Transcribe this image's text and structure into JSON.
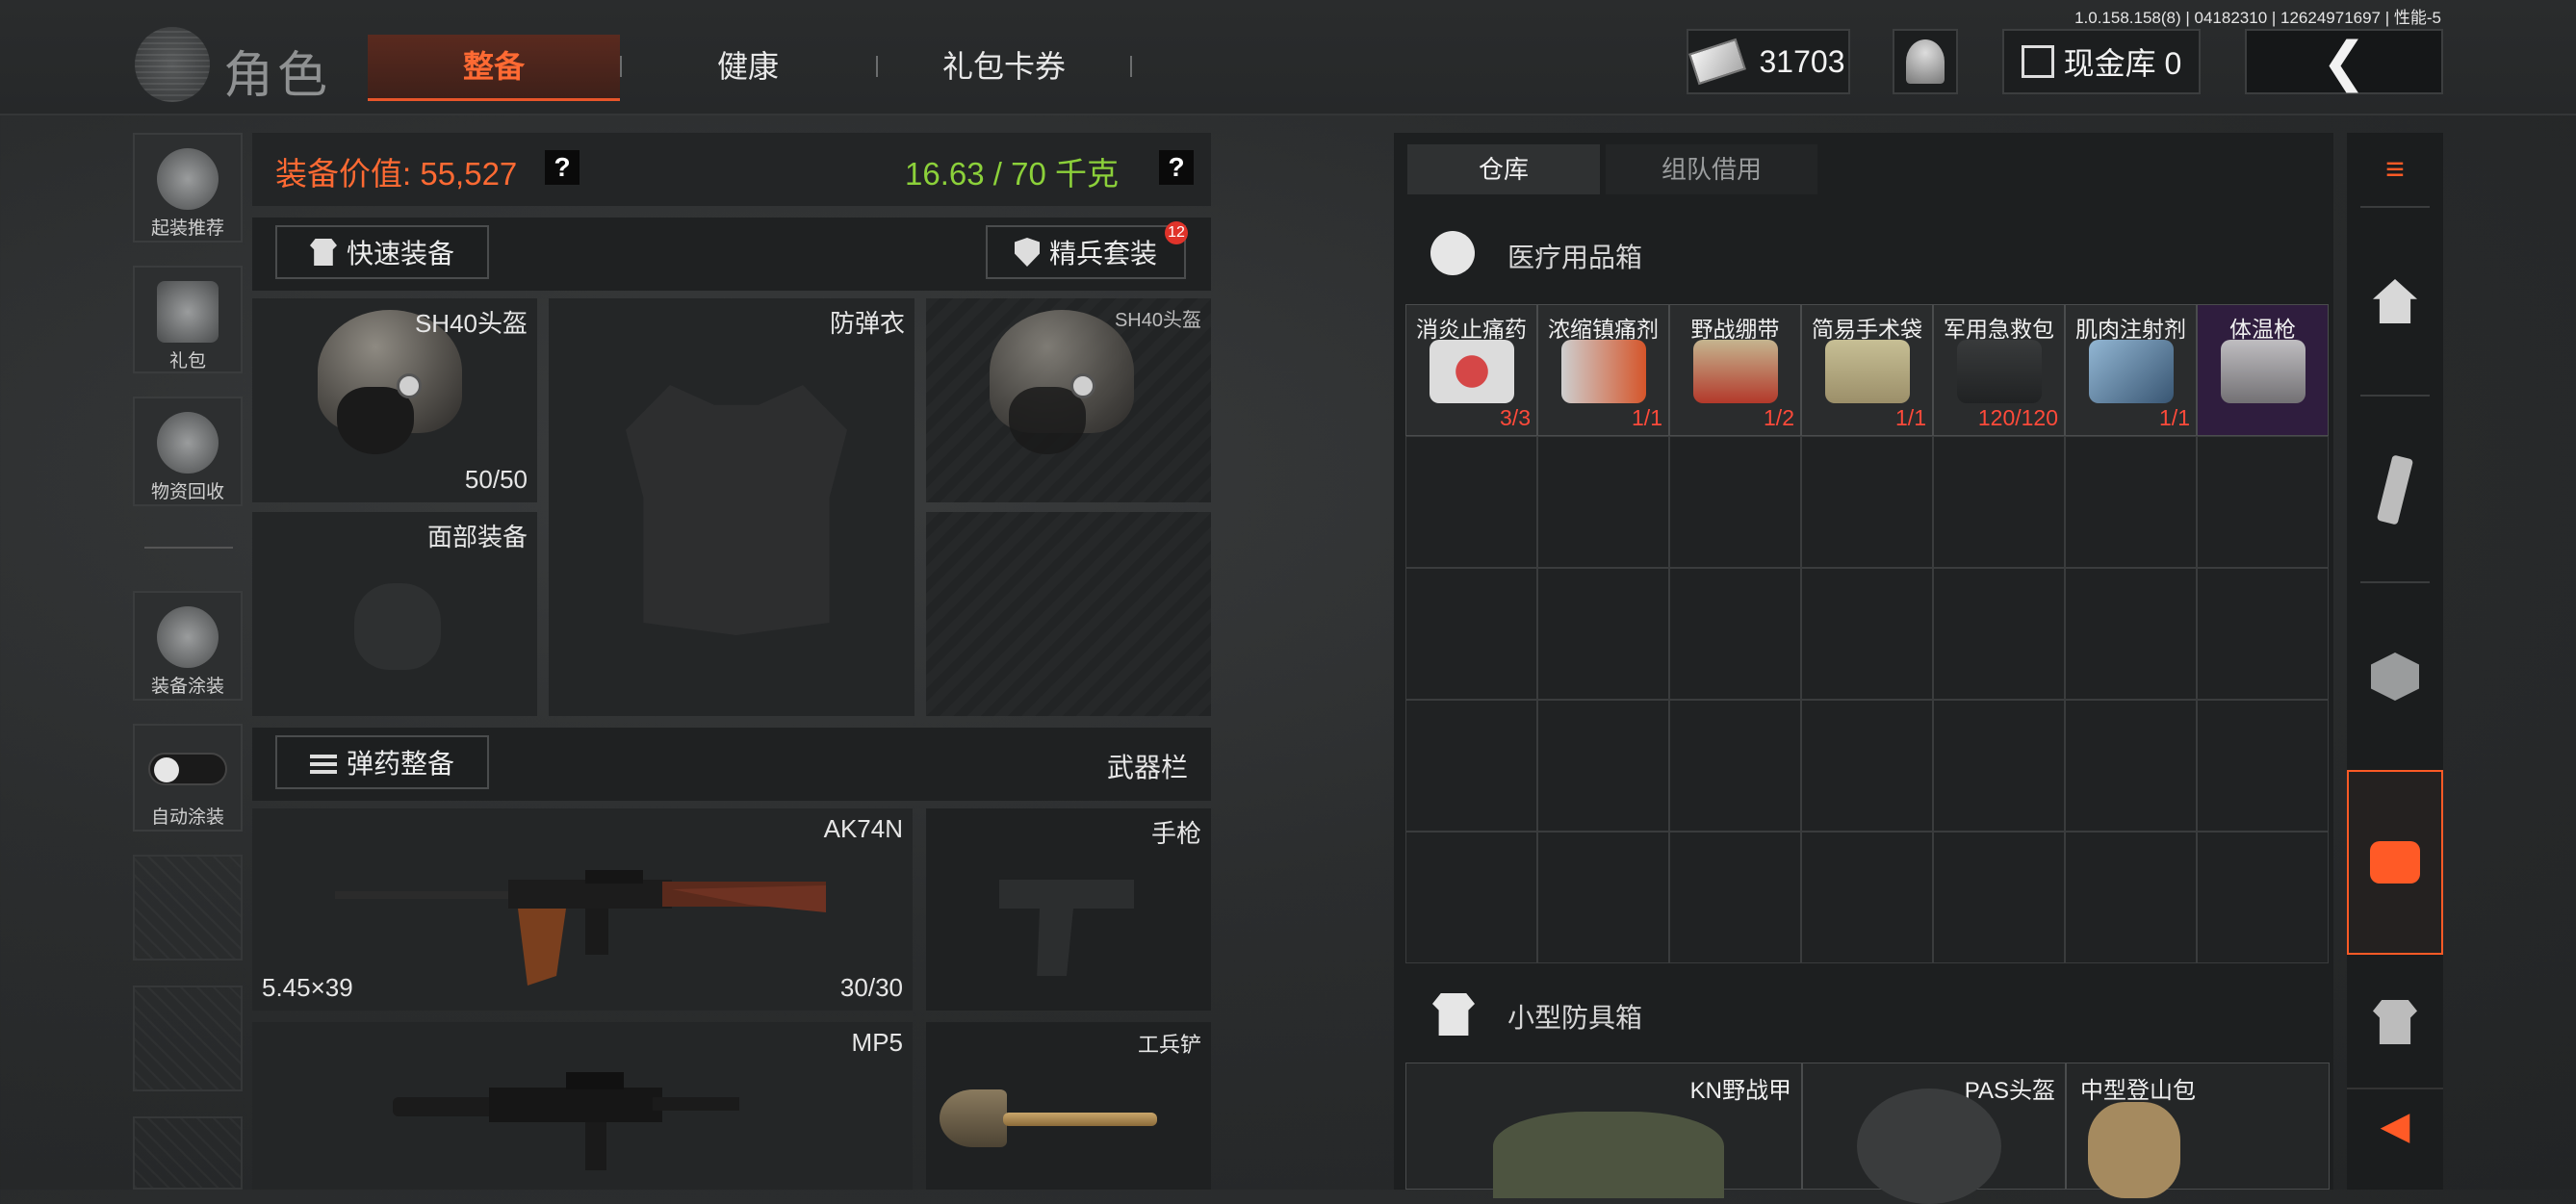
{
  "version_text": "1.0.158.158(8) | 04182310 | 12624971697 | 性能-5",
  "app_title": "角色",
  "tabs": [
    {
      "label": "整备",
      "active": true
    },
    {
      "label": "健康",
      "active": false
    },
    {
      "label": "礼包卡券",
      "active": false
    }
  ],
  "top_right": {
    "currency_value": "31703",
    "vault_label": "现金库 0"
  },
  "side_menu": [
    {
      "label": "起装推荐",
      "icon": "helmet-grid-icon"
    },
    {
      "label": "礼包",
      "icon": "gift-icon"
    },
    {
      "label": "物资回收",
      "icon": "recycle-icon"
    },
    {
      "label": "装备涂装",
      "icon": "paint-icon"
    },
    {
      "label": "自动涂装",
      "icon": "toggle-switch"
    }
  ],
  "loadout": {
    "value_label": "装备价值: 55,527",
    "weight_label": "16.63 / 70 千克",
    "quick_equip_label": "快速装备",
    "elite_set_label": "精兵套装",
    "elite_set_badge": "12",
    "ammo_label": "弹药整备",
    "weapon_bar_label": "武器栏",
    "helmet": {
      "name": "SH40头盔",
      "durability": "50/50"
    },
    "vest_label": "防弹衣",
    "helmet2_name": "SH40头盔",
    "face_label": "面部装备",
    "primary": {
      "name": "AK74N",
      "caliber": "5.45×39",
      "ammo": "30/30"
    },
    "pistol_label": "手枪",
    "secondary": {
      "name": "MP5"
    },
    "melee_label": "工兵铲"
  },
  "storage": {
    "tabs": [
      {
        "label": "仓库",
        "active": true
      },
      {
        "label": "组队借用",
        "active": false
      }
    ],
    "medical_section_title": "医疗用品箱",
    "medical_items": [
      {
        "name": "消炎止痛药",
        "count": "3/3"
      },
      {
        "name": "浓缩镇痛剂",
        "count": "1/1"
      },
      {
        "name": "野战绷带",
        "count": "1/2"
      },
      {
        "name": "简易手术袋",
        "count": "1/1"
      },
      {
        "name": "军用急救包",
        "count": "120/120"
      },
      {
        "name": "肌肉注射剂",
        "count": "1/1"
      },
      {
        "name": "体温枪",
        "count": ""
      }
    ],
    "armor_section_title": "小型防具箱",
    "armor_items": [
      {
        "name": "KN野战甲"
      },
      {
        "name": "PAS头盔"
      },
      {
        "name": "中型登山包"
      }
    ]
  },
  "colors": {
    "accent": "#ff5a26",
    "weight_green": "#8cd13a",
    "value_orange": "#ff6a33",
    "count_red": "#ff4a3a"
  }
}
